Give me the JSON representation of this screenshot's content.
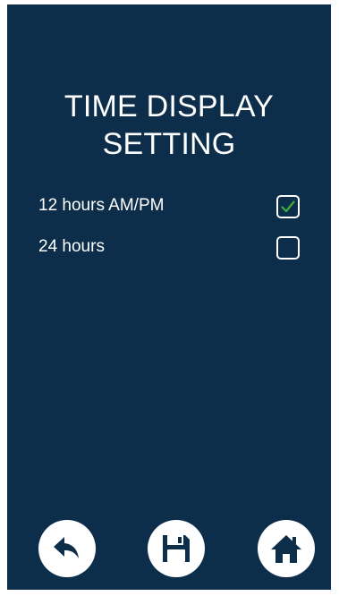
{
  "title": {
    "line1": "TIME DISPLAY",
    "line2": "SETTING"
  },
  "options": [
    {
      "label": "12 hours AM/PM",
      "checked": true
    },
    {
      "label": "24 hours",
      "checked": false
    }
  ],
  "colors": {
    "background": "#0d2e4a",
    "text": "#ffffff",
    "check": "#3fae3a",
    "button_bg": "#ffffff",
    "button_icon": "#0d2e4a"
  },
  "buttons": [
    {
      "icon": "back-icon",
      "action": "back"
    },
    {
      "icon": "save-icon",
      "action": "save"
    },
    {
      "icon": "home-icon",
      "action": "home"
    }
  ]
}
